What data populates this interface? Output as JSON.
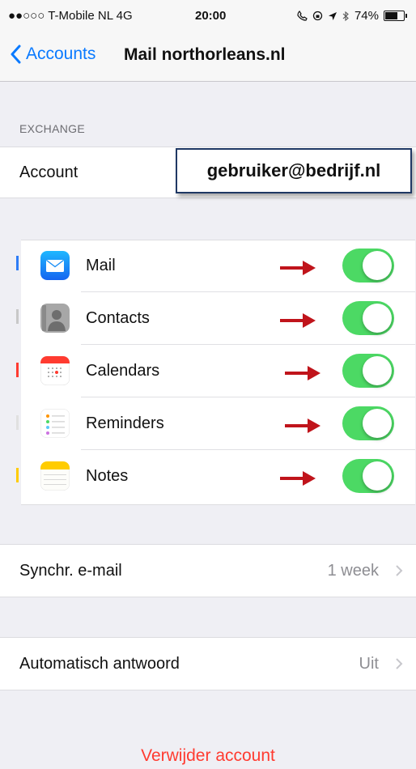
{
  "status_bar": {
    "carrier": "●●○○○ T-Mobile NL  4G",
    "time": "20:00",
    "icons": [
      "phone-icon",
      "lock-rotation-icon",
      "location-icon",
      "bluetooth-icon"
    ],
    "battery_text": "74%",
    "battery_level": 0.74
  },
  "nav": {
    "back_label": "Accounts",
    "title": "Mail northorleans.nl"
  },
  "exchange": {
    "section_header": "EXCHANGE",
    "account_label": "Account",
    "account_value": "gebruiker@bedrijf.nl"
  },
  "services": [
    {
      "label": "Mail",
      "icon": "mail-app-icon",
      "enabled": true
    },
    {
      "label": "Contacts",
      "icon": "contacts-app-icon",
      "enabled": true
    },
    {
      "label": "Calendars",
      "icon": "calendar-app-icon",
      "enabled": true
    },
    {
      "label": "Reminders",
      "icon": "reminders-app-icon",
      "enabled": true
    },
    {
      "label": "Notes",
      "icon": "notes-app-icon",
      "enabled": true
    }
  ],
  "sync": {
    "label": "Synchr. e-mail",
    "value": "1 week"
  },
  "auto_reply": {
    "label": "Automatisch antwoord",
    "value": "Uit"
  },
  "delete_label": "Verwijder account",
  "colors": {
    "accent": "#0a7aff",
    "toggle_on": "#4cd964",
    "destructive": "#ff3b30",
    "arrow": "#c0141b",
    "background": "#efeff4"
  }
}
